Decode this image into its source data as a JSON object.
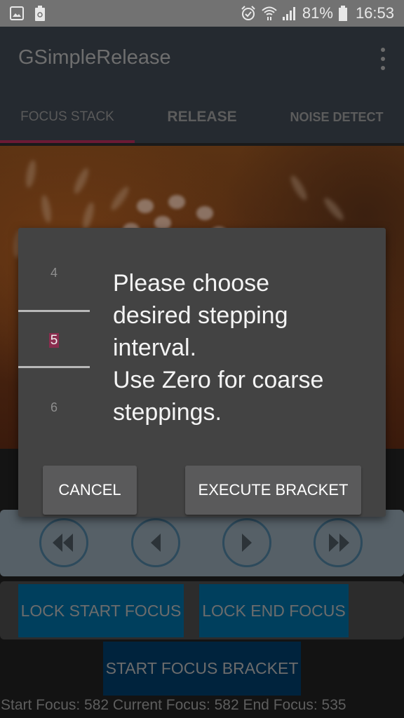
{
  "status_bar": {
    "notification_icons": [
      "gallery-icon",
      "recycle-battery-icon"
    ],
    "system_icons": [
      "alarm-icon",
      "wifi-icon",
      "signal-icon",
      "battery-icon"
    ],
    "battery_percent": "81%",
    "time": "16:53"
  },
  "app_bar": {
    "title": "GSimpleRelease",
    "overflow_icon": "more-vert-icon"
  },
  "tabs": [
    {
      "label": "FOCUS STACK",
      "active": true
    },
    {
      "label": "RELEASE",
      "active": false
    },
    {
      "label": "NOISE DETECT",
      "active": false
    }
  ],
  "accent_color": "#6b1a35",
  "nav_controls": [
    {
      "name": "fast-rewind",
      "icon": "fast-rewind-icon"
    },
    {
      "name": "step-back",
      "icon": "step-back-icon"
    },
    {
      "name": "step-forward",
      "icon": "step-forward-icon"
    },
    {
      "name": "fast-forward",
      "icon": "fast-forward-icon"
    }
  ],
  "buttons": {
    "lock_start": "LOCK START FOCUS",
    "lock_end": "LOCK END FOCUS",
    "start_bracket": "START FOCUS BRACKET"
  },
  "focus_status": "Start Focus: 582 Current Focus: 582 End Focus: 535",
  "dialog": {
    "picker": {
      "prev": "4",
      "selected": "5",
      "next": "6"
    },
    "message": "Please choose\ndesired stepping\ninterval.\nUse Zero for coarse\nsteppings.",
    "cancel_label": "CANCEL",
    "execute_label": "EXECUTE BRACKET"
  }
}
